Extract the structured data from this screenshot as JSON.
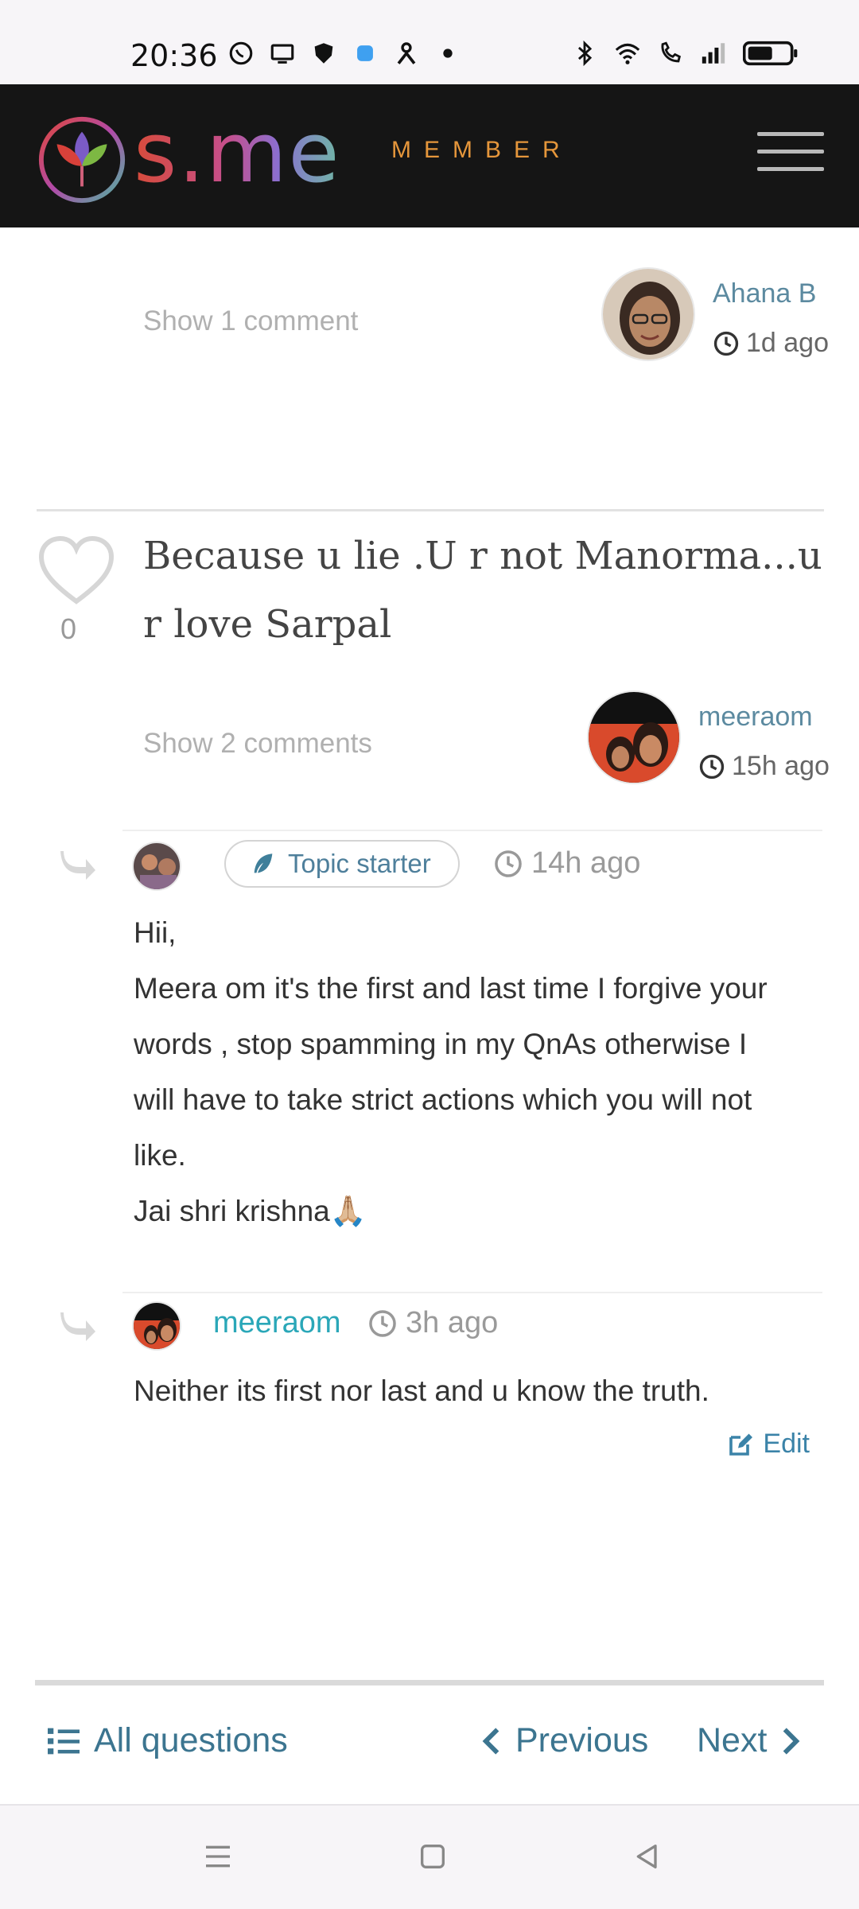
{
  "status_bar": {
    "time": "20:36",
    "left_icons": [
      "whatsapp-icon",
      "screen-icon",
      "shield-icon",
      "app-icon",
      "person-icon",
      "dot-icon"
    ],
    "right_icons": [
      "bluetooth-icon",
      "wifi-icon",
      "volte-call-icon",
      "signal-icon",
      "battery-icon"
    ]
  },
  "header": {
    "logo_text": "s.me",
    "member_label": "MEMBER",
    "menu_icon": "hamburger-icon",
    "colors": {
      "background": "#151515",
      "member": "#e5963b"
    }
  },
  "previous_answer": {
    "show_comments": "Show 1 comment",
    "author": "Ahana B",
    "time": "1d ago"
  },
  "question": {
    "votes": "0",
    "text": "Because u lie .U r not Manorma...u r love Sarpal",
    "show_comments": "Show 2 comments",
    "author": "meeraom",
    "time": "15h ago"
  },
  "comments": [
    {
      "badge": "Topic starter",
      "time": "14h ago",
      "lines": [
        "Hii,",
        "Meera om it's the first and last time I forgive your",
        "words , stop spamming in my QnAs otherwise I",
        "will have to take strict actions which you will not",
        "like.",
        "Jai shri krishna🙏🏼"
      ]
    },
    {
      "author": "meeraom",
      "time": "3h ago",
      "text": "Neither its first nor last and u know the truth.",
      "edit_label": "Edit"
    }
  ],
  "bottom_nav": {
    "all_questions": "All questions",
    "previous": "Previous",
    "next": "Next"
  }
}
